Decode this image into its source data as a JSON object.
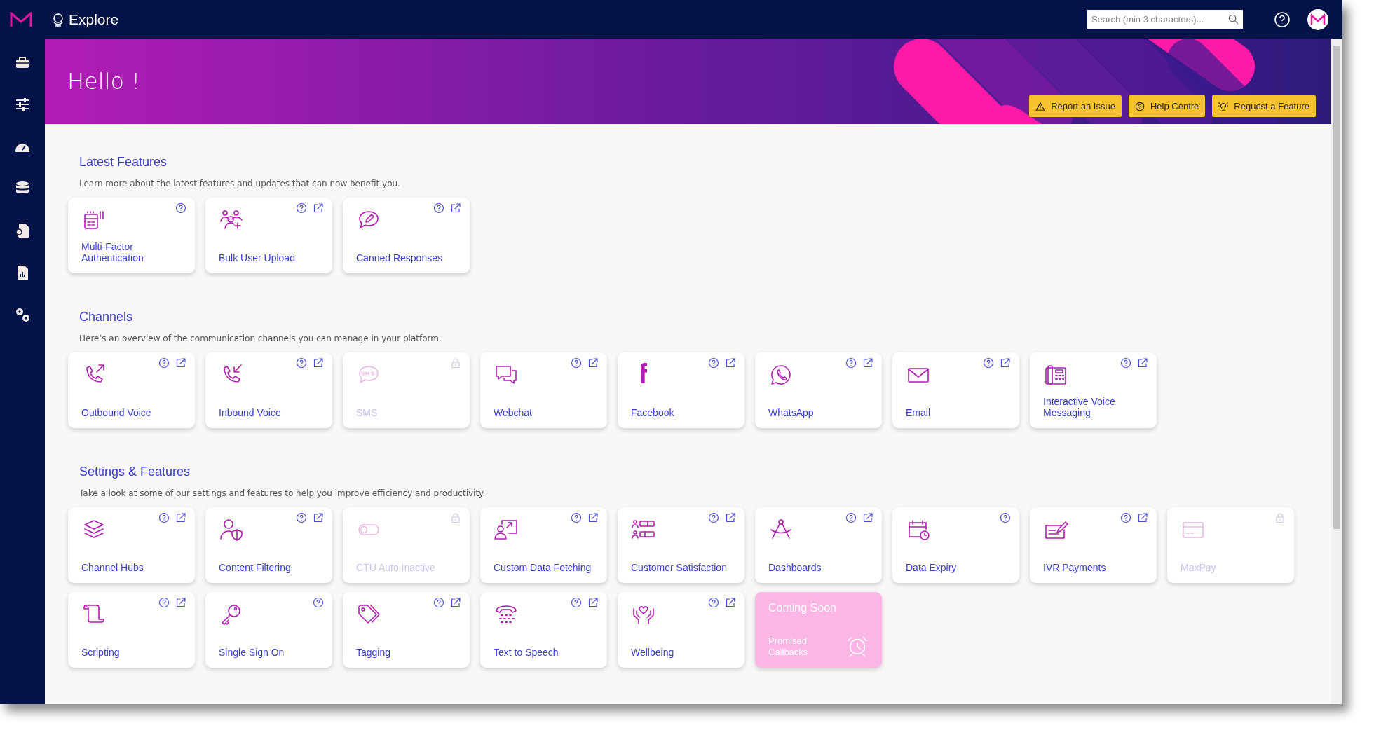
{
  "topbar": {
    "title": "Explore",
    "search": {
      "placeholder": "Search (min 3 characters)..."
    }
  },
  "banner": {
    "greeting": "Hello !",
    "buttons": [
      {
        "label": "Report an Issue",
        "kind": "warning"
      },
      {
        "label": "Help Centre",
        "kind": "help"
      },
      {
        "label": "Request a Feature",
        "kind": "idea"
      }
    ]
  },
  "sections": [
    {
      "title": "Latest Features",
      "description": "Learn more about the latest features and updates that can now benefit you.",
      "cards": [
        {
          "kind": "feature",
          "label": "Multi-Factor Authentication",
          "help": true,
          "external": false,
          "locked": false
        },
        {
          "kind": "feature",
          "label": "Bulk User Upload",
          "help": true,
          "external": true,
          "locked": false
        },
        {
          "kind": "feature",
          "label": "Canned Responses",
          "help": true,
          "external": true,
          "locked": false
        }
      ]
    },
    {
      "title": "Channels",
      "description": "Here’s an overview of the communication channels you can manage in your platform.",
      "cards": [
        {
          "kind": "feature",
          "label": "Outbound Voice",
          "help": true,
          "external": true,
          "locked": false
        },
        {
          "kind": "feature",
          "label": "Inbound Voice",
          "help": true,
          "external": true,
          "locked": false
        },
        {
          "kind": "feature",
          "label": "SMS",
          "help": false,
          "external": false,
          "locked": true
        },
        {
          "kind": "feature",
          "label": "Webchat",
          "help": true,
          "external": true,
          "locked": false
        },
        {
          "kind": "feature",
          "label": "Facebook",
          "help": true,
          "external": true,
          "locked": false
        },
        {
          "kind": "feature",
          "label": "WhatsApp",
          "help": true,
          "external": true,
          "locked": false
        },
        {
          "kind": "feature",
          "label": "Email",
          "help": true,
          "external": true,
          "locked": false
        },
        {
          "kind": "feature",
          "label": "Interactive Voice Messaging",
          "help": true,
          "external": true,
          "locked": false
        }
      ]
    },
    {
      "title": "Settings & Features",
      "description": "Take a look at some of our settings and features to help you improve efficiency and productivity.",
      "cards": [
        {
          "kind": "feature",
          "label": "Channel Hubs",
          "help": true,
          "external": true,
          "locked": false
        },
        {
          "kind": "feature",
          "label": "Content Filtering",
          "help": true,
          "external": true,
          "locked": false
        },
        {
          "kind": "feature",
          "label": "CTU Auto Inactive",
          "help": false,
          "external": false,
          "locked": true
        },
        {
          "kind": "feature",
          "label": "Custom Data Fetching",
          "help": true,
          "external": true,
          "locked": false
        },
        {
          "kind": "feature",
          "label": "Customer Satisfaction",
          "help": true,
          "external": true,
          "locked": false
        },
        {
          "kind": "feature",
          "label": "Dashboards",
          "help": true,
          "external": true,
          "locked": false
        },
        {
          "kind": "feature",
          "label": "Data Expiry",
          "help": true,
          "external": false,
          "locked": false
        },
        {
          "kind": "feature",
          "label": "IVR Payments",
          "help": true,
          "external": true,
          "locked": false
        },
        {
          "kind": "feature",
          "label": "MaxPay",
          "help": false,
          "external": false,
          "locked": true
        },
        {
          "kind": "feature",
          "label": "Scripting",
          "help": true,
          "external": true,
          "locked": false
        },
        {
          "kind": "feature",
          "label": "Single Sign On",
          "help": true,
          "external": false,
          "locked": false
        },
        {
          "kind": "feature",
          "label": "Tagging",
          "help": true,
          "external": true,
          "locked": false
        },
        {
          "kind": "feature",
          "label": "Text to Speech",
          "help": true,
          "external": true,
          "locked": false
        },
        {
          "kind": "feature",
          "label": "Wellbeing",
          "help": true,
          "external": true,
          "locked": false
        },
        {
          "kind": "coming_soon",
          "badge": "Coming Soon",
          "label": "Promised Callbacks"
        }
      ]
    }
  ]
}
